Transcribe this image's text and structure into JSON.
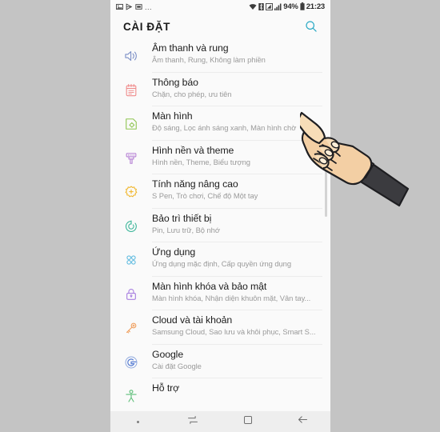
{
  "statusbar": {
    "left_icons": [
      "photo-icon",
      "send-icon",
      "sim-icon"
    ],
    "overflow": "...",
    "right_icons": [
      "wifi-icon",
      "bluetooth-icon",
      "signal-icon",
      "signal-bars-icon"
    ],
    "battery_percent": "94%",
    "battery_icon": "battery-icon",
    "clock": "21:23"
  },
  "header": {
    "title": "CÀI ĐẶT",
    "search_icon": "search-icon",
    "search_color": "#27a8c4"
  },
  "list": {
    "items": [
      {
        "icon": "sound-icon",
        "color": "#7a8ec6",
        "title": "Âm thanh và rung",
        "subtitle": "Âm thanh, Rung, Không làm phiền"
      },
      {
        "icon": "notification-icon",
        "color": "#ef8a8a",
        "title": "Thông báo",
        "subtitle": "Chặn, cho phép, ưu tiên"
      },
      {
        "icon": "display-icon",
        "color": "#8dc44f",
        "title": "Màn hình",
        "subtitle": "Độ sáng, Lọc ánh sáng xanh, Màn hình chờ"
      },
      {
        "icon": "wallpaper-theme-icon",
        "color": "#b57fd4",
        "title": "Hình nền và theme",
        "subtitle": "Hình nền, Theme, Biểu tượng"
      },
      {
        "icon": "advanced-features-icon",
        "color": "#f0b323",
        "title": "Tính năng nâng cao",
        "subtitle": "S Pen, Trò chơi, Chế độ Một tay"
      },
      {
        "icon": "device-maintenance-icon",
        "color": "#3fb79b",
        "title": "Bảo trì thiết bị",
        "subtitle": "Pin, Lưu trữ, Bộ nhớ"
      },
      {
        "icon": "apps-icon",
        "color": "#62bce0",
        "title": "Ứng dụng",
        "subtitle": "Ứng dụng mặc định, Cấp quyền ứng dụng"
      },
      {
        "icon": "lock-icon",
        "color": "#a87fe0",
        "title": "Màn hình khóa và bảo mật",
        "subtitle": "Màn hình khóa, Nhận diện khuôn mặt, Vân tay..."
      },
      {
        "icon": "key-icon",
        "color": "#f0a060",
        "title": "Cloud và tài khoản",
        "subtitle": "Samsung Cloud, Sao lưu và khôi phục, Smart S..."
      },
      {
        "icon": "google-icon",
        "color": "#5a7fd4",
        "title": "Google",
        "subtitle": "Cài đặt Google"
      },
      {
        "icon": "accessibility-icon",
        "color": "#5fbf7a",
        "title": "Hỗ trợ",
        "subtitle": ""
      }
    ]
  },
  "navbar": {
    "buttons": [
      {
        "name": "nav-dot",
        "label": ""
      },
      {
        "name": "nav-recents-icon",
        "label": ""
      },
      {
        "name": "nav-home-icon",
        "label": ""
      },
      {
        "name": "nav-back-icon",
        "label": ""
      }
    ]
  },
  "cursor": {
    "type": "pointing-hand-cursor",
    "points_at": "Màn hình"
  }
}
